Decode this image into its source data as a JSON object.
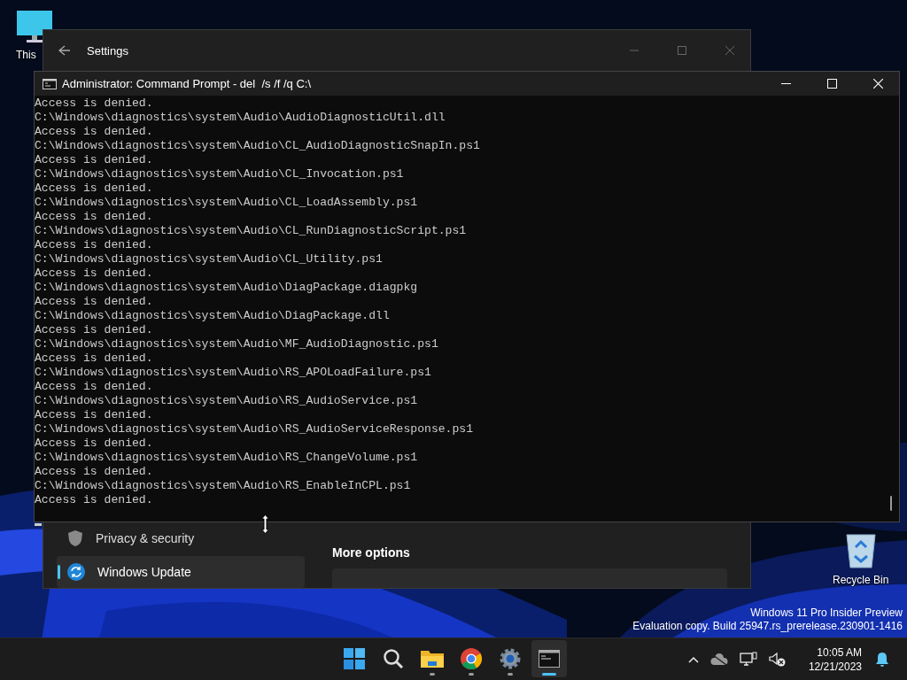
{
  "desktop_icons": [
    {
      "kind": "computer",
      "label": "This"
    },
    {
      "kind": "recycle",
      "label": "Recycle Bin"
    }
  ],
  "settings": {
    "title": "Settings",
    "sidebar": [
      {
        "kind": "shield",
        "label": "Privacy & security",
        "selected": false
      },
      {
        "kind": "update",
        "label": "Windows Update",
        "selected": true
      }
    ],
    "section_heading": "More options"
  },
  "console": {
    "title": "Administrator: Command Prompt - del  /s /f /q C:\\",
    "lines": [
      "Access is denied.",
      "C:\\Windows\\diagnostics\\system\\Audio\\AudioDiagnosticUtil.dll",
      "Access is denied.",
      "C:\\Windows\\diagnostics\\system\\Audio\\CL_AudioDiagnosticSnapIn.ps1",
      "Access is denied.",
      "C:\\Windows\\diagnostics\\system\\Audio\\CL_Invocation.ps1",
      "Access is denied.",
      "C:\\Windows\\diagnostics\\system\\Audio\\CL_LoadAssembly.ps1",
      "Access is denied.",
      "C:\\Windows\\diagnostics\\system\\Audio\\CL_RunDiagnosticScript.ps1",
      "Access is denied.",
      "C:\\Windows\\diagnostics\\system\\Audio\\CL_Utility.ps1",
      "Access is denied.",
      "C:\\Windows\\diagnostics\\system\\Audio\\DiagPackage.diagpkg",
      "Access is denied.",
      "C:\\Windows\\diagnostics\\system\\Audio\\DiagPackage.dll",
      "Access is denied.",
      "C:\\Windows\\diagnostics\\system\\Audio\\MF_AudioDiagnostic.ps1",
      "Access is denied.",
      "C:\\Windows\\diagnostics\\system\\Audio\\RS_APOLoadFailure.ps1",
      "Access is denied.",
      "C:\\Windows\\diagnostics\\system\\Audio\\RS_AudioService.ps1",
      "Access is denied.",
      "C:\\Windows\\diagnostics\\system\\Audio\\RS_AudioServiceResponse.ps1",
      "Access is denied.",
      "C:\\Windows\\diagnostics\\system\\Audio\\RS_ChangeVolume.ps1",
      "Access is denied.",
      "C:\\Windows\\diagnostics\\system\\Audio\\RS_EnableInCPL.ps1",
      "Access is denied."
    ]
  },
  "watermark": [
    "Windows 11 Pro Insider Preview",
    "Evaluation copy. Build 25947.rs_prerelease.230901-1416"
  ],
  "taskbar": {
    "apps": [
      {
        "kind": "start",
        "running": false,
        "selected": false
      },
      {
        "kind": "search",
        "running": false,
        "selected": false
      },
      {
        "kind": "folder",
        "running": true,
        "selected": false
      },
      {
        "kind": "browser",
        "running": true,
        "selected": false
      },
      {
        "kind": "settings",
        "running": true,
        "selected": false
      },
      {
        "kind": "terminal",
        "running": true,
        "selected": true
      }
    ],
    "tray": [
      {
        "kind": "chevron"
      },
      {
        "kind": "cloud"
      },
      {
        "kind": "network"
      },
      {
        "kind": "volume"
      }
    ],
    "clock": {
      "time": "10:05 AM",
      "date": "12/21/2023"
    }
  }
}
